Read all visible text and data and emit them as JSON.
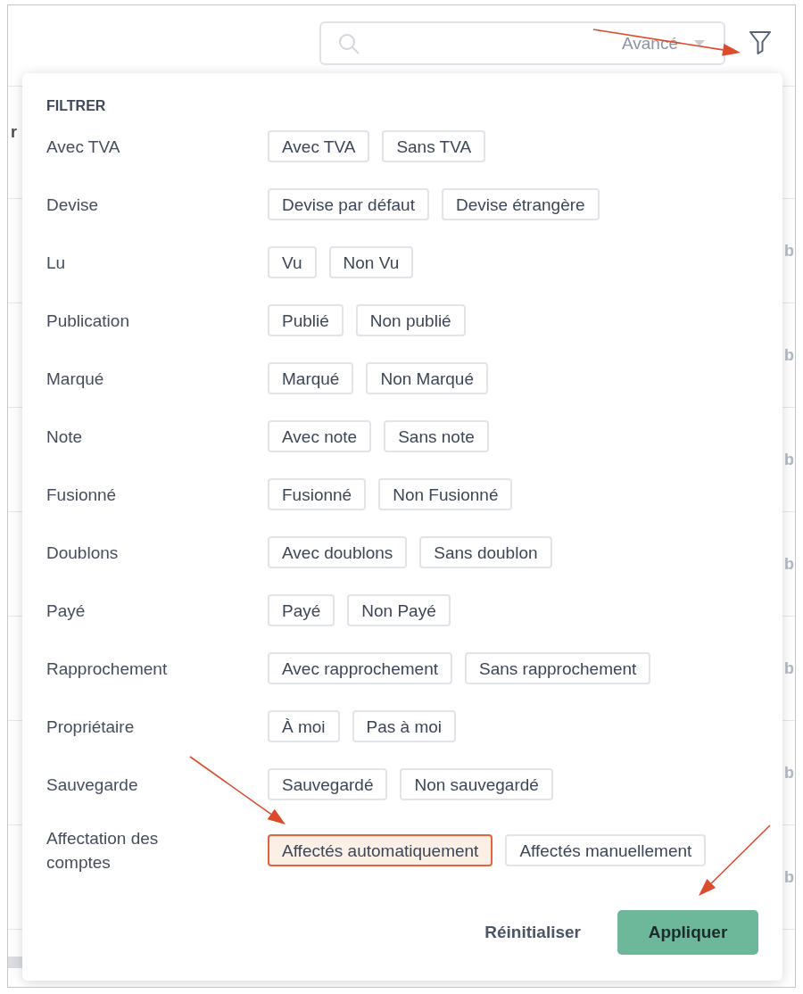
{
  "search": {
    "mode_dropdown": "Avancé"
  },
  "background_table": {
    "header_fragment": "r",
    "rows": [
      {
        "fragment": "b"
      },
      {
        "fragment": "b"
      },
      {
        "fragment": "b"
      },
      {
        "fragment": "b"
      },
      {
        "fragment": "b"
      },
      {
        "fragment": "b"
      },
      {
        "fragment": "b"
      }
    ]
  },
  "filter_panel": {
    "title": "FILTRER",
    "groups": [
      {
        "label": "Avec TVA",
        "options": [
          {
            "label": "Avec TVA",
            "selected": false
          },
          {
            "label": "Sans TVA",
            "selected": false
          }
        ]
      },
      {
        "label": "Devise",
        "options": [
          {
            "label": "Devise par défaut",
            "selected": false
          },
          {
            "label": "Devise étrangère",
            "selected": false
          }
        ]
      },
      {
        "label": "Lu",
        "options": [
          {
            "label": "Vu",
            "selected": false
          },
          {
            "label": "Non Vu",
            "selected": false
          }
        ]
      },
      {
        "label": "Publication",
        "options": [
          {
            "label": "Publié",
            "selected": false
          },
          {
            "label": "Non publié",
            "selected": false
          }
        ]
      },
      {
        "label": "Marqué",
        "options": [
          {
            "label": "Marqué",
            "selected": false
          },
          {
            "label": "Non Marqué",
            "selected": false
          }
        ]
      },
      {
        "label": "Note",
        "options": [
          {
            "label": "Avec note",
            "selected": false
          },
          {
            "label": "Sans note",
            "selected": false
          }
        ]
      },
      {
        "label": "Fusionné",
        "options": [
          {
            "label": "Fusionné",
            "selected": false
          },
          {
            "label": "Non Fusionné",
            "selected": false
          }
        ]
      },
      {
        "label": "Doublons",
        "options": [
          {
            "label": "Avec doublons",
            "selected": false
          },
          {
            "label": "Sans doublon",
            "selected": false
          }
        ]
      },
      {
        "label": "Payé",
        "options": [
          {
            "label": "Payé",
            "selected": false
          },
          {
            "label": "Non Payé",
            "selected": false
          }
        ]
      },
      {
        "label": "Rapprochement",
        "options": [
          {
            "label": "Avec rapprochement",
            "selected": false
          },
          {
            "label": "Sans rapprochement",
            "selected": false
          }
        ]
      },
      {
        "label": "Propriétaire",
        "options": [
          {
            "label": "À moi",
            "selected": false
          },
          {
            "label": "Pas à moi",
            "selected": false
          }
        ]
      },
      {
        "label": "Sauvegarde",
        "options": [
          {
            "label": "Sauvegardé",
            "selected": false
          },
          {
            "label": "Non sauvegardé",
            "selected": false
          }
        ]
      },
      {
        "label": "Affectation des comptes",
        "options": [
          {
            "label": "Affectés automatiquement",
            "selected": true
          },
          {
            "label": "Affectés manuellement",
            "selected": false
          }
        ]
      }
    ],
    "actions": [
      {
        "label": "Réinitialiser",
        "kind": "secondary"
      },
      {
        "label": "Appliquer",
        "kind": "primary"
      }
    ]
  }
}
